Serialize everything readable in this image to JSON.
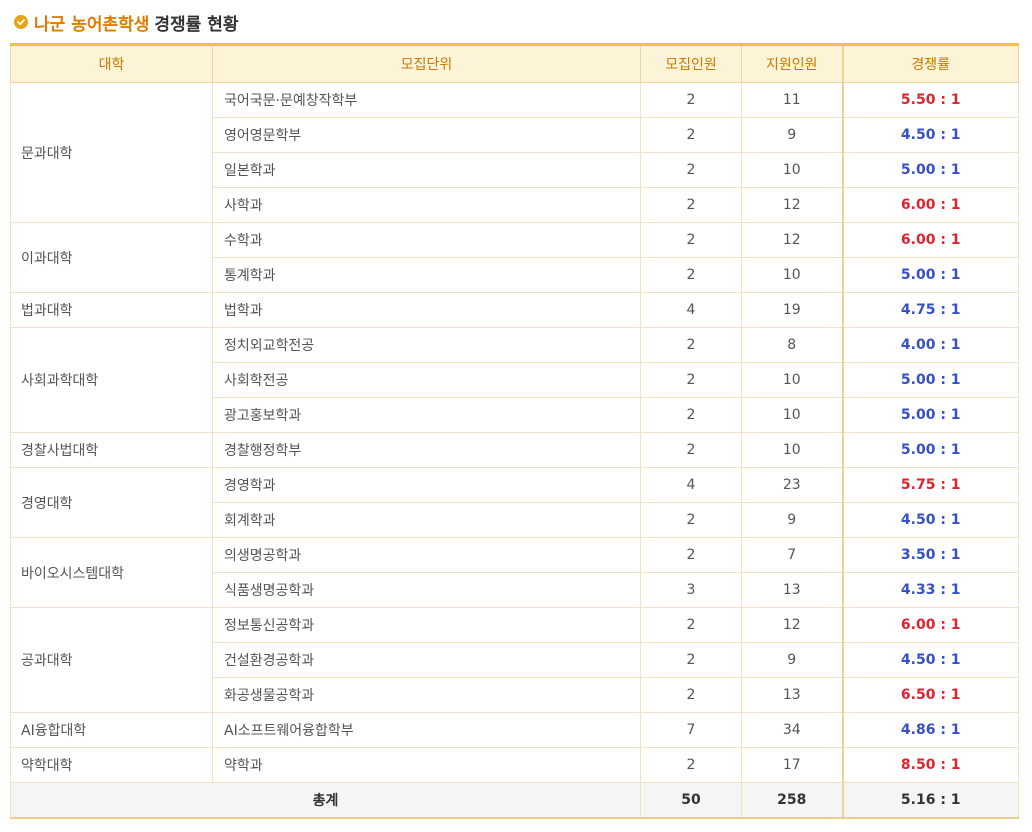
{
  "title": {
    "highlight": "나군 농어촌학생",
    "rest": "경쟁률 현황"
  },
  "headers": {
    "college": "대학",
    "unit": "모집단위",
    "quota": "모집인원",
    "applicants": "지원인원",
    "rate": "경쟁률"
  },
  "colors": {
    "accent": "#e8a317",
    "red": "#e3222f",
    "blue": "#3550c8",
    "header_bg": "#fdf3d6"
  },
  "rows": [
    {
      "college": "문과대학",
      "span": 4,
      "unit": "국어국문·문예창작학부",
      "quota": "2",
      "applicants": "11",
      "rate": "5.50 : 1",
      "hl": "red"
    },
    {
      "unit": "영어영문학부",
      "quota": "2",
      "applicants": "9",
      "rate": "4.50 : 1",
      "hl": "blue"
    },
    {
      "unit": "일본학과",
      "quota": "2",
      "applicants": "10",
      "rate": "5.00 : 1",
      "hl": "blue"
    },
    {
      "unit": "사학과",
      "quota": "2",
      "applicants": "12",
      "rate": "6.00 : 1",
      "hl": "red"
    },
    {
      "college": "이과대학",
      "span": 2,
      "unit": "수학과",
      "quota": "2",
      "applicants": "12",
      "rate": "6.00 : 1",
      "hl": "red"
    },
    {
      "unit": "통계학과",
      "quota": "2",
      "applicants": "10",
      "rate": "5.00 : 1",
      "hl": "blue"
    },
    {
      "college": "법과대학",
      "span": 1,
      "unit": "법학과",
      "quota": "4",
      "applicants": "19",
      "rate": "4.75 : 1",
      "hl": "blue"
    },
    {
      "college": "사회과학대학",
      "span": 3,
      "unit": "정치외교학전공",
      "quota": "2",
      "applicants": "8",
      "rate": "4.00 : 1",
      "hl": "blue"
    },
    {
      "unit": "사회학전공",
      "quota": "2",
      "applicants": "10",
      "rate": "5.00 : 1",
      "hl": "blue"
    },
    {
      "unit": "광고홍보학과",
      "quota": "2",
      "applicants": "10",
      "rate": "5.00 : 1",
      "hl": "blue"
    },
    {
      "college": "경찰사법대학",
      "span": 1,
      "unit": "경찰행정학부",
      "quota": "2",
      "applicants": "10",
      "rate": "5.00 : 1",
      "hl": "blue"
    },
    {
      "college": "경영대학",
      "span": 2,
      "unit": "경영학과",
      "quota": "4",
      "applicants": "23",
      "rate": "5.75 : 1",
      "hl": "red"
    },
    {
      "unit": "회계학과",
      "quota": "2",
      "applicants": "9",
      "rate": "4.50 : 1",
      "hl": "blue"
    },
    {
      "college": "바이오시스템대학",
      "span": 2,
      "unit": "의생명공학과",
      "quota": "2",
      "applicants": "7",
      "rate": "3.50 : 1",
      "hl": "blue"
    },
    {
      "unit": "식품생명공학과",
      "quota": "3",
      "applicants": "13",
      "rate": "4.33 : 1",
      "hl": "blue"
    },
    {
      "college": "공과대학",
      "span": 3,
      "unit": "정보통신공학과",
      "quota": "2",
      "applicants": "12",
      "rate": "6.00 : 1",
      "hl": "red"
    },
    {
      "unit": "건설환경공학과",
      "quota": "2",
      "applicants": "9",
      "rate": "4.50 : 1",
      "hl": "blue"
    },
    {
      "unit": "화공생물공학과",
      "quota": "2",
      "applicants": "13",
      "rate": "6.50 : 1",
      "hl": "red"
    },
    {
      "college": "AI융합대학",
      "span": 1,
      "unit": "AI소프트웨어융합학부",
      "quota": "7",
      "applicants": "34",
      "rate": "4.86 : 1",
      "hl": "blue"
    },
    {
      "college": "약학대학",
      "span": 1,
      "unit": "약학과",
      "quota": "2",
      "applicants": "17",
      "rate": "8.50 : 1",
      "hl": "red"
    }
  ],
  "total": {
    "label": "총계",
    "quota": "50",
    "applicants": "258",
    "rate": "5.16 : 1"
  }
}
